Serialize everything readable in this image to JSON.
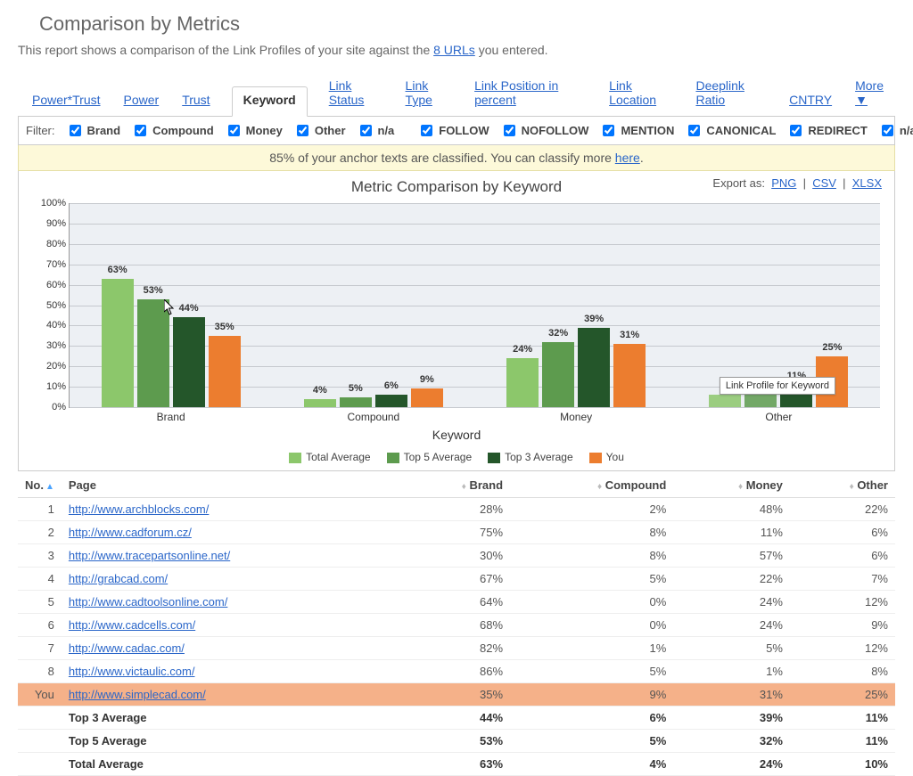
{
  "page_title": "Comparison by Metrics",
  "subtitle_pre": "This report shows a comparison of the Link Profiles of your site against the ",
  "subtitle_link": "8 URLs",
  "subtitle_post": " you entered.",
  "tabs": [
    "Power*Trust",
    "Power",
    "Trust",
    "Keyword",
    "Link Status",
    "Link Type",
    "Link Position in percent",
    "Link Location",
    "Deeplink Ratio",
    "CNTRY",
    "More ▼"
  ],
  "active_tab_index": 3,
  "filter_label": "Filter:",
  "filter_groups": [
    "Brand",
    "Compound",
    "Money",
    "Other",
    "n/a"
  ],
  "filter_rel": [
    "FOLLOW",
    "NOFOLLOW",
    "MENTION",
    "CANONICAL",
    "REDIRECT",
    "n/a"
  ],
  "notice_pre": "85% of your anchor texts are classified. You can classify more ",
  "notice_link": "here",
  "notice_post": ".",
  "export_label": "Export as:",
  "export_formats": [
    "PNG",
    "CSV",
    "XLSX"
  ],
  "chart_data": {
    "type": "bar",
    "title": "Metric Comparison by Keyword",
    "xlabel": "Keyword",
    "ylabel": "",
    "ylim": [
      0,
      100
    ],
    "yticks": [
      0,
      10,
      20,
      30,
      40,
      50,
      60,
      70,
      80,
      90,
      100
    ],
    "categories": [
      "Brand",
      "Compound",
      "Money",
      "Other"
    ],
    "series": [
      {
        "name": "Total Average",
        "color": "#8cc76b",
        "values": [
          63,
          4,
          24,
          null
        ]
      },
      {
        "name": "Top 5 Average",
        "color": "#5d9b4e",
        "values": [
          53,
          5,
          32,
          null
        ]
      },
      {
        "name": "Top 3 Average",
        "color": "#24562a",
        "values": [
          44,
          6,
          39,
          11
        ]
      },
      {
        "name": "You",
        "color": "#ec7d2f",
        "values": [
          35,
          9,
          31,
          25
        ]
      }
    ],
    "tooltip_text": "Link Profile for Keyword"
  },
  "colors": {
    "totalavg": "#8cc76b",
    "top5": "#5d9b4e",
    "top3": "#24562a",
    "you": "#ec7d2f"
  },
  "table": {
    "headers": [
      "No.",
      "Page",
      "Brand",
      "Compound",
      "Money",
      "Other"
    ],
    "rows": [
      {
        "no": "1",
        "page": "http://www.archblocks.com/",
        "brand": "28%",
        "compound": "2%",
        "money": "48%",
        "other": "22%"
      },
      {
        "no": "2",
        "page": "http://www.cadforum.cz/",
        "brand": "75%",
        "compound": "8%",
        "money": "11%",
        "other": "6%"
      },
      {
        "no": "3",
        "page": "http://www.tracepartsonline.net/",
        "brand": "30%",
        "compound": "8%",
        "money": "57%",
        "other": "6%"
      },
      {
        "no": "4",
        "page": "http://grabcad.com/",
        "brand": "67%",
        "compound": "5%",
        "money": "22%",
        "other": "7%"
      },
      {
        "no": "5",
        "page": "http://www.cadtoolsonline.com/",
        "brand": "64%",
        "compound": "0%",
        "money": "24%",
        "other": "12%"
      },
      {
        "no": "6",
        "page": "http://www.cadcells.com/",
        "brand": "68%",
        "compound": "0%",
        "money": "24%",
        "other": "9%"
      },
      {
        "no": "7",
        "page": "http://www.cadac.com/",
        "brand": "82%",
        "compound": "1%",
        "money": "5%",
        "other": "12%"
      },
      {
        "no": "8",
        "page": "http://www.victaulic.com/",
        "brand": "86%",
        "compound": "5%",
        "money": "1%",
        "other": "8%"
      }
    ],
    "you": {
      "no": "You",
      "page": "http://www.simplecad.com/",
      "brand": "35%",
      "compound": "9%",
      "money": "31%",
      "other": "25%"
    },
    "averages": [
      {
        "label": "Top 3 Average",
        "brand": "44%",
        "compound": "6%",
        "money": "39%",
        "other": "11%"
      },
      {
        "label": "Top 5 Average",
        "brand": "53%",
        "compound": "5%",
        "money": "32%",
        "other": "11%"
      },
      {
        "label": "Total Average",
        "brand": "63%",
        "compound": "4%",
        "money": "24%",
        "other": "10%"
      }
    ]
  }
}
